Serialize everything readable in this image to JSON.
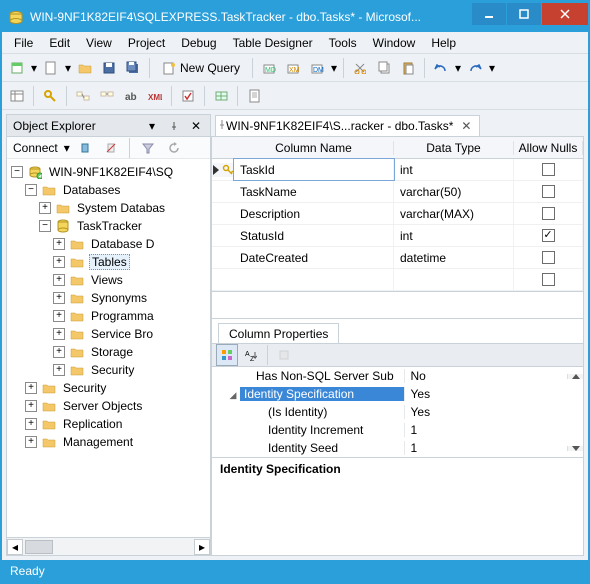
{
  "window": {
    "title": "WIN-9NF1K82EIF4\\SQLEXPRESS.TaskTracker - dbo.Tasks* - Microsof..."
  },
  "menu": {
    "items": [
      "File",
      "Edit",
      "View",
      "Project",
      "Debug",
      "Table Designer",
      "Tools",
      "Window",
      "Help"
    ]
  },
  "toolbar": {
    "newQuery": "New Query"
  },
  "objectExplorer": {
    "title": "Object Explorer",
    "connect": "Connect",
    "server": "WIN-9NF1K82EIF4\\SQ",
    "databases": "Databases",
    "sysdb": "System Databas",
    "taskTracker": "TaskTracker",
    "ttChildren": [
      "Database D",
      "Tables",
      "Views",
      "Synonyms",
      "Programma",
      "Service Bro",
      "Storage",
      "Security"
    ],
    "topLevel": [
      "Security",
      "Server Objects",
      "Replication",
      "Management"
    ]
  },
  "docTab": {
    "label": "WIN-9NF1K82EIF4\\S...racker - dbo.Tasks*"
  },
  "columns": {
    "headers": [
      "Column Name",
      "Data Type",
      "Allow Nulls"
    ],
    "rows": [
      {
        "name": "TaskId",
        "type": "int",
        "nulls": false,
        "pk": true,
        "editing": true
      },
      {
        "name": "TaskName",
        "type": "varchar(50)",
        "nulls": false
      },
      {
        "name": "Description",
        "type": "varchar(MAX)",
        "nulls": false
      },
      {
        "name": "StatusId",
        "type": "int",
        "nulls": true
      },
      {
        "name": "DateCreated",
        "type": "datetime",
        "nulls": false
      }
    ]
  },
  "properties": {
    "tab": "Column Properties",
    "rows": [
      {
        "indent": 1,
        "collapse": "",
        "name": "Has Non-SQL Server Sub",
        "value": "No"
      },
      {
        "indent": 0,
        "collapse": "▿",
        "name": "Identity Specification",
        "value": "Yes",
        "selected": true
      },
      {
        "indent": 2,
        "collapse": "",
        "name": "(Is Identity)",
        "value": "Yes"
      },
      {
        "indent": 2,
        "collapse": "",
        "name": "Identity Increment",
        "value": "1"
      },
      {
        "indent": 2,
        "collapse": "",
        "name": "Identity Seed",
        "value": "1"
      }
    ],
    "descTitle": "Identity Specification"
  },
  "status": {
    "text": "Ready"
  }
}
